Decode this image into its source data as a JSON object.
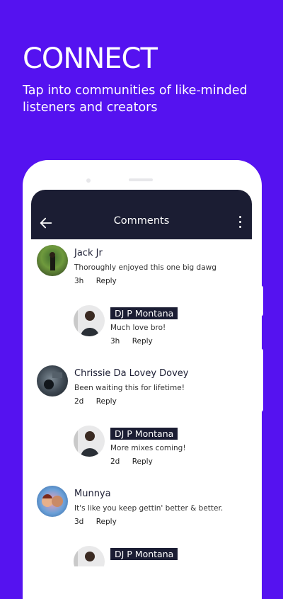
{
  "promo": {
    "headline": "CONNECT",
    "subline": "Tap into communities of like-minded listeners and creators"
  },
  "appbar": {
    "title": "Comments"
  },
  "comments": [
    {
      "name": "Jack Jr",
      "text": "Thoroughly enjoyed this one big dawg",
      "time": "3h",
      "reply": "Reply",
      "is_reply": false
    },
    {
      "name": "DJ P Montana",
      "text": "Much love bro!",
      "time": "3h",
      "reply": "Reply",
      "is_reply": true
    },
    {
      "name": "Chrissie Da Lovey Dovey",
      "text": "Been waiting this for lifetime!",
      "time": "2d",
      "reply": "Reply",
      "is_reply": false
    },
    {
      "name": "DJ P Montana",
      "text": "More mixes coming!",
      "time": "2d",
      "reply": "Reply",
      "is_reply": true
    },
    {
      "name": "Munnya",
      "text": "It's like you keep gettin' better & better.",
      "time": "3d",
      "reply": "Reply",
      "is_reply": false
    },
    {
      "name": "DJ P Montana",
      "text": "",
      "time": "",
      "reply": "",
      "is_reply": true
    }
  ],
  "colors": {
    "background": "#5512f0",
    "appbar": "#1b1d33",
    "tag": "#1b1d33"
  }
}
